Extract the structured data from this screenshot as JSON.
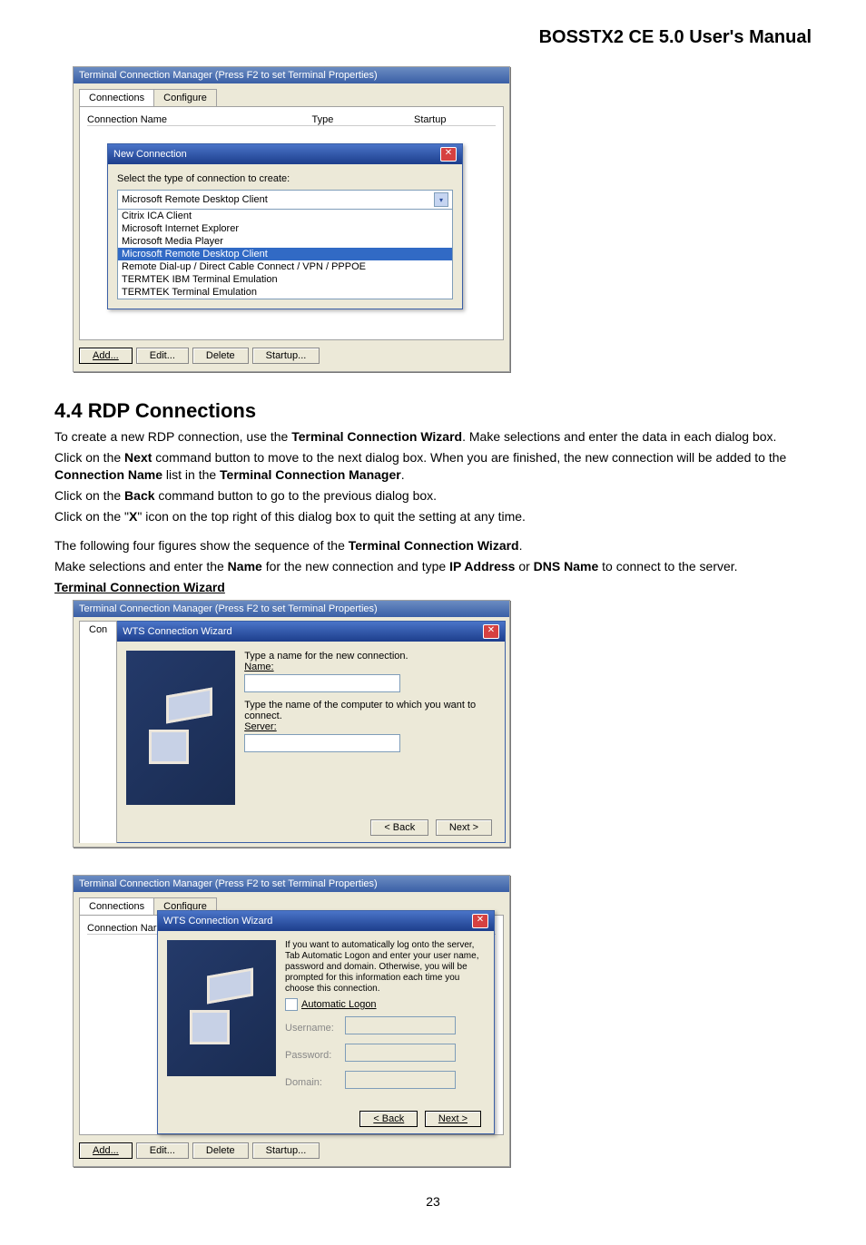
{
  "doc_title": "BOSSTX2 CE 5.0 User's Manual",
  "page_number": "23",
  "shot1": {
    "window_title": "Terminal Connection Manager (Press F2 to set Terminal Properties)",
    "tab_connections": "Connections",
    "tab_configure": "Configure",
    "col_name": "Connection Name",
    "col_type": "Type",
    "col_startup": "Startup",
    "dialog_title": "New Connection",
    "dialog_prompt": "Select the type of connection to create:",
    "selected_option": "Microsoft Remote Desktop Client",
    "options": [
      "Citrix ICA Client",
      "Microsoft Internet Explorer",
      "Microsoft Media Player",
      "Microsoft Remote Desktop Client",
      "Remote Dial-up / Direct Cable Connect / VPN / PPPOE",
      "TERMTEK IBM Terminal Emulation",
      "TERMTEK Terminal Emulation"
    ],
    "btn_add": "Add...",
    "btn_edit": "Edit...",
    "btn_delete": "Delete",
    "btn_startup": "Startup..."
  },
  "section_heading": "4.4  RDP Connections",
  "para1a": "To create a new RDP connection, use the ",
  "para1b": "Terminal Connection Wizard",
  "para1c": ". Make selections and enter the data in each dialog box.",
  "para2a": "Click on the ",
  "para2b": "Next",
  "para2c": " command button to move to the next dialog box. When you are finished, the new connection will be added to the ",
  "para2d": "Connection Name",
  "para2e": " list in the ",
  "para2f": "Terminal Connection Manager",
  "para2g": ".",
  "para3a": "Click on the ",
  "para3b": "Back",
  "para3c": " command button to go to the previous dialog box.",
  "para4a": "Click on the \"",
  "para4b": "X",
  "para4c": "\" icon on the top right of this dialog box to quit the setting at any time.",
  "para5a": "The following four figures show the sequence of the ",
  "para5b": "Terminal Connection Wizard",
  "para5c": ".",
  "para6a": "Make selections and enter the ",
  "para6b": "Name",
  "para6c": " for the new connection and type ",
  "para6d": "IP Address",
  "para6e": " or ",
  "para6f": "DNS Name",
  "para6g": " to connect to the server.",
  "caption_wizard": "Terminal Connection Wizard",
  "shot2": {
    "outer_title": "Terminal Connection Manager (Press F2 to set Terminal Properties)",
    "tab_prefix": "Con",
    "wiz_title": "WTS Connection Wizard",
    "prompt_name": "Type a name for the new connection.",
    "label_name": "Name:",
    "prompt_server": "Type the name of the computer to which you want to connect.",
    "label_server": "Server:",
    "btn_back": "< Back",
    "btn_next": "Next >"
  },
  "shot3": {
    "outer_title": "Terminal Connection Manager (Press F2 to set Terminal Properties)",
    "tab_connections": "Connections",
    "tab_configure": "Configure",
    "col_name_prefix": "Connection Nar",
    "wiz_title": "WTS Connection Wizard",
    "body_text": "If you want to automatically log onto the server, Tab Automatic Logon and enter your user name, password and domain. Otherwise, you will be prompted for this information each time you choose this connection.",
    "chk_label": "Automatic Logon",
    "lbl_user": "Username:",
    "lbl_pass": "Password:",
    "lbl_domain": "Domain:",
    "btn_back": "< Back",
    "btn_next": "Next >",
    "btn_add": "Add...",
    "btn_edit": "Edit...",
    "btn_delete": "Delete",
    "btn_startup": "Startup..."
  }
}
